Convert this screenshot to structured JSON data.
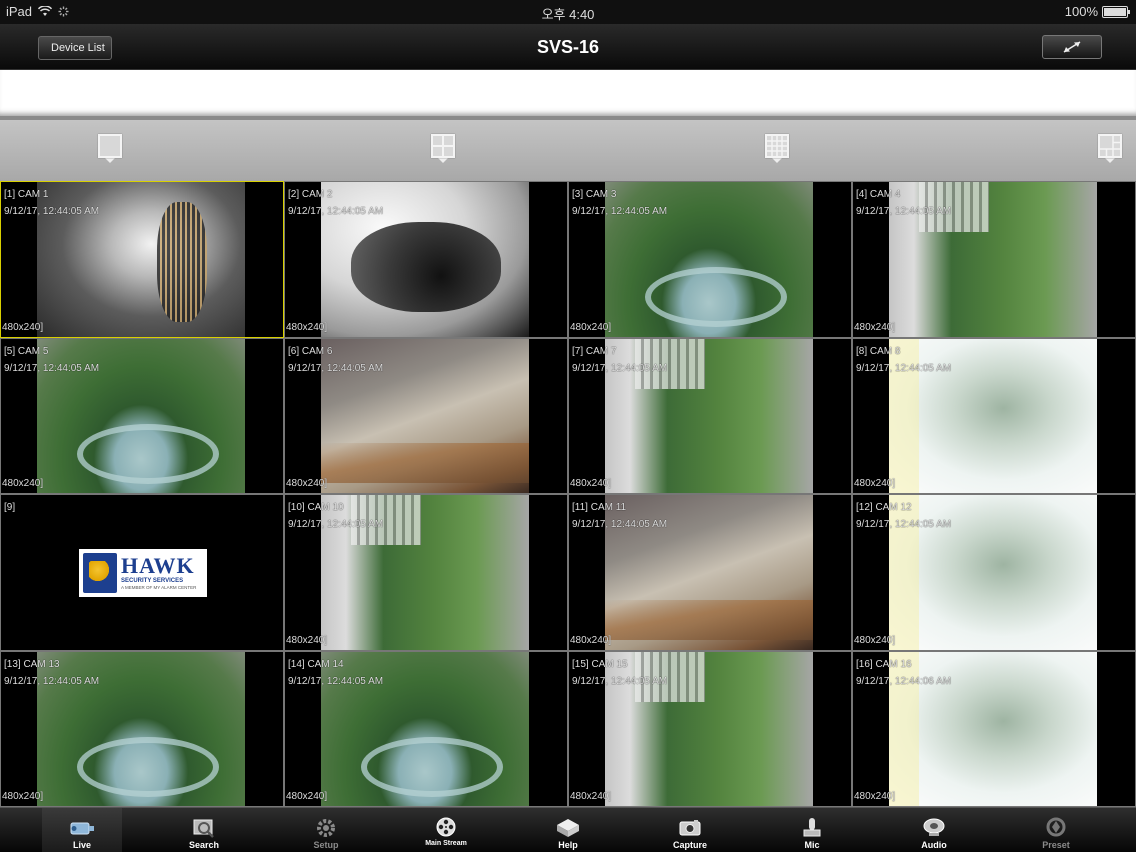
{
  "status_bar": {
    "device": "iPad",
    "time": "오후 4:40",
    "battery": "100%"
  },
  "nav": {
    "back_label": "Device List",
    "title": "SVS-16"
  },
  "cameras": [
    {
      "label": "[1] CAM 1",
      "time": "9/12/17, 12:44:05 AM",
      "res": "480x240]"
    },
    {
      "label": "[2] CAM 2",
      "time": "9/12/17, 12:44:05 AM",
      "res": "480x240]"
    },
    {
      "label": "[3] CAM 3",
      "time": "9/12/17, 12:44:05 AM",
      "res": "480x240]"
    },
    {
      "label": "[4] CAM 4",
      "time": "9/12/17, 12:44:05 AM",
      "res": "480x240]"
    },
    {
      "label": "[5] CAM 5",
      "time": "9/12/17, 12:44:05 AM",
      "res": "480x240]"
    },
    {
      "label": "[6] CAM 6",
      "time": "9/12/17, 12:44:05 AM",
      "res": "480x240]"
    },
    {
      "label": "[7] CAM 7",
      "time": "9/12/17, 12:44:05 AM",
      "res": "480x240]"
    },
    {
      "label": "[8] CAM 8",
      "time": "9/12/17, 12:44:05 AM",
      "res": "480x240]"
    },
    {
      "label": "[9]",
      "time": "",
      "res": ""
    },
    {
      "label": "[10] CAM 10",
      "time": "9/12/17, 12:44:05 AM",
      "res": "480x240]"
    },
    {
      "label": "[11] CAM 11",
      "time": "9/12/17, 12:44:05 AM",
      "res": "480x240]"
    },
    {
      "label": "[12] CAM 12",
      "time": "9/12/17, 12:44:05 AM",
      "res": "480x240]"
    },
    {
      "label": "[13] CAM 13",
      "time": "9/12/17, 12:44:05 AM",
      "res": "480x240]"
    },
    {
      "label": "[14] CAM 14",
      "time": "9/12/17, 12:44:05 AM",
      "res": "480x240]"
    },
    {
      "label": "[15] CAM 15",
      "time": "9/12/17, 12:44:05 AM",
      "res": "480x240]"
    },
    {
      "label": "[16] CAM 16",
      "time": "9/12/17, 12:44:06 AM",
      "res": "480x240]"
    }
  ],
  "hawk_logo": {
    "name": "HAWK",
    "sub": "SECURITY SERVICES",
    "tag": "A MEMBER OF MY ALARM CENTER"
  },
  "tabs": [
    {
      "label": "Live",
      "icon": "camera-icon"
    },
    {
      "label": "Search",
      "icon": "search-icon"
    },
    {
      "label": "Setup",
      "icon": "gear-icon"
    },
    {
      "label": "Main Stream",
      "icon": "film-reel-icon"
    },
    {
      "label": "Help",
      "icon": "help-icon"
    },
    {
      "label": "Capture",
      "icon": "capture-icon"
    },
    {
      "label": "Mic",
      "icon": "mic-icon"
    },
    {
      "label": "Audio",
      "icon": "speaker-icon"
    },
    {
      "label": "Preset",
      "icon": "preset-icon"
    }
  ],
  "colors": {
    "selected_border": "#d8d000",
    "hawk_blue": "#1d3f8f"
  }
}
